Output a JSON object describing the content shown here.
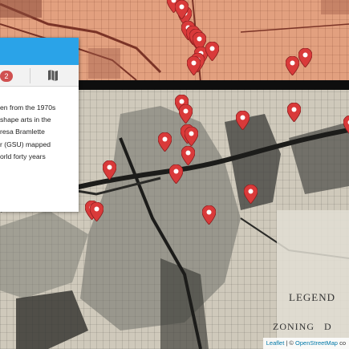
{
  "panel": {
    "badge_count": "2",
    "map_tab_icon": "map-icon",
    "body_lines": [
      "en from the 1970s",
      "shape arts in the",
      "resa Bramlette",
      "r (GSU) mapped",
      "orld forty years"
    ]
  },
  "map_labels": {
    "legend": "LEGEND",
    "zoning": "ZONING   D"
  },
  "attribution": {
    "leaflet": "Leaflet",
    "separator": " | © ",
    "osm": "OpenStreetMap",
    "rest": " co"
  },
  "marker_color": "#d93a3a",
  "marker_count": 37
}
